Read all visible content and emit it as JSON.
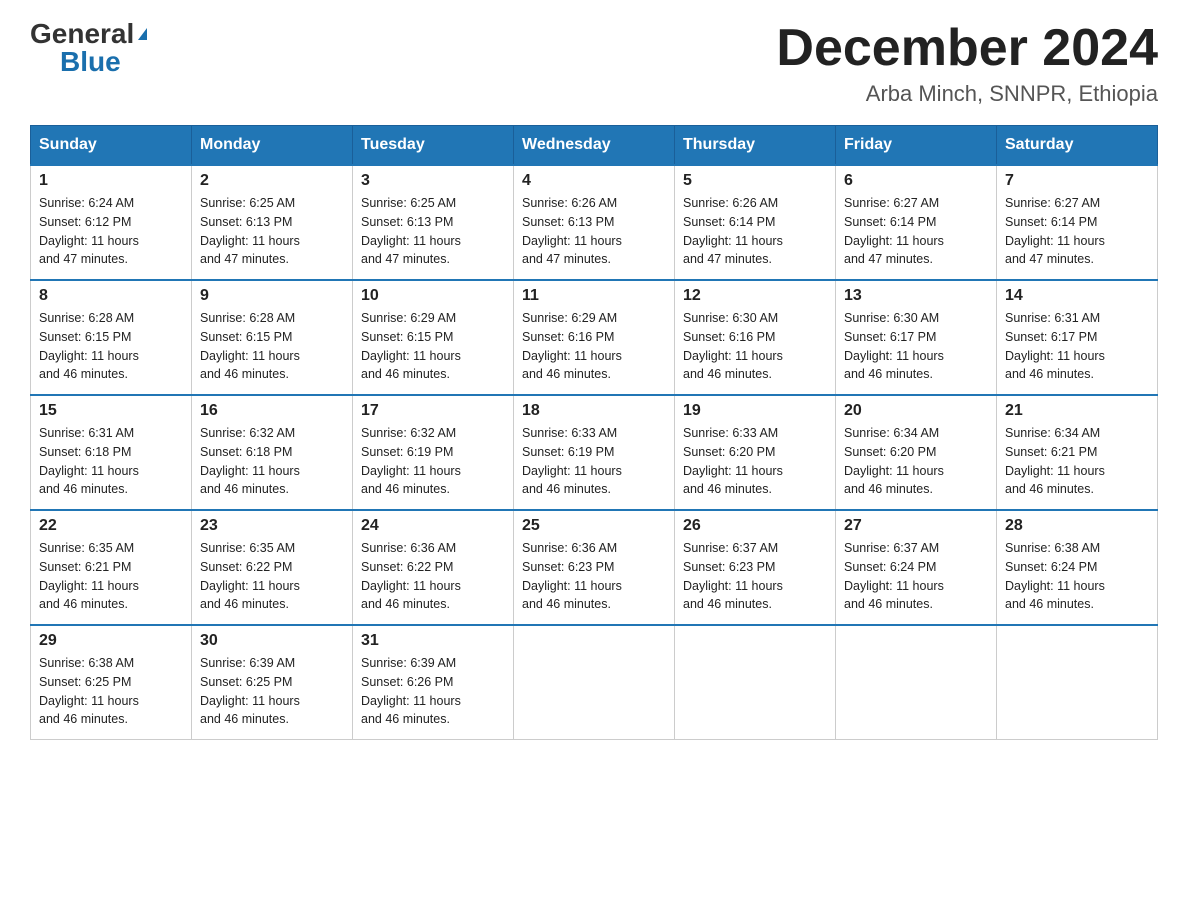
{
  "logo": {
    "general": "General",
    "blue": "Blue",
    "triangle": "▲"
  },
  "header": {
    "month": "December 2024",
    "location": "Arba Minch, SNNPR, Ethiopia"
  },
  "days_of_week": [
    "Sunday",
    "Monday",
    "Tuesday",
    "Wednesday",
    "Thursday",
    "Friday",
    "Saturday"
  ],
  "weeks": [
    [
      {
        "day": "1",
        "sunrise": "6:24 AM",
        "sunset": "6:12 PM",
        "daylight": "11 hours and 47 minutes."
      },
      {
        "day": "2",
        "sunrise": "6:25 AM",
        "sunset": "6:13 PM",
        "daylight": "11 hours and 47 minutes."
      },
      {
        "day": "3",
        "sunrise": "6:25 AM",
        "sunset": "6:13 PM",
        "daylight": "11 hours and 47 minutes."
      },
      {
        "day": "4",
        "sunrise": "6:26 AM",
        "sunset": "6:13 PM",
        "daylight": "11 hours and 47 minutes."
      },
      {
        "day": "5",
        "sunrise": "6:26 AM",
        "sunset": "6:14 PM",
        "daylight": "11 hours and 47 minutes."
      },
      {
        "day": "6",
        "sunrise": "6:27 AM",
        "sunset": "6:14 PM",
        "daylight": "11 hours and 47 minutes."
      },
      {
        "day": "7",
        "sunrise": "6:27 AM",
        "sunset": "6:14 PM",
        "daylight": "11 hours and 47 minutes."
      }
    ],
    [
      {
        "day": "8",
        "sunrise": "6:28 AM",
        "sunset": "6:15 PM",
        "daylight": "11 hours and 46 minutes."
      },
      {
        "day": "9",
        "sunrise": "6:28 AM",
        "sunset": "6:15 PM",
        "daylight": "11 hours and 46 minutes."
      },
      {
        "day": "10",
        "sunrise": "6:29 AM",
        "sunset": "6:15 PM",
        "daylight": "11 hours and 46 minutes."
      },
      {
        "day": "11",
        "sunrise": "6:29 AM",
        "sunset": "6:16 PM",
        "daylight": "11 hours and 46 minutes."
      },
      {
        "day": "12",
        "sunrise": "6:30 AM",
        "sunset": "6:16 PM",
        "daylight": "11 hours and 46 minutes."
      },
      {
        "day": "13",
        "sunrise": "6:30 AM",
        "sunset": "6:17 PM",
        "daylight": "11 hours and 46 minutes."
      },
      {
        "day": "14",
        "sunrise": "6:31 AM",
        "sunset": "6:17 PM",
        "daylight": "11 hours and 46 minutes."
      }
    ],
    [
      {
        "day": "15",
        "sunrise": "6:31 AM",
        "sunset": "6:18 PM",
        "daylight": "11 hours and 46 minutes."
      },
      {
        "day": "16",
        "sunrise": "6:32 AM",
        "sunset": "6:18 PM",
        "daylight": "11 hours and 46 minutes."
      },
      {
        "day": "17",
        "sunrise": "6:32 AM",
        "sunset": "6:19 PM",
        "daylight": "11 hours and 46 minutes."
      },
      {
        "day": "18",
        "sunrise": "6:33 AM",
        "sunset": "6:19 PM",
        "daylight": "11 hours and 46 minutes."
      },
      {
        "day": "19",
        "sunrise": "6:33 AM",
        "sunset": "6:20 PM",
        "daylight": "11 hours and 46 minutes."
      },
      {
        "day": "20",
        "sunrise": "6:34 AM",
        "sunset": "6:20 PM",
        "daylight": "11 hours and 46 minutes."
      },
      {
        "day": "21",
        "sunrise": "6:34 AM",
        "sunset": "6:21 PM",
        "daylight": "11 hours and 46 minutes."
      }
    ],
    [
      {
        "day": "22",
        "sunrise": "6:35 AM",
        "sunset": "6:21 PM",
        "daylight": "11 hours and 46 minutes."
      },
      {
        "day": "23",
        "sunrise": "6:35 AM",
        "sunset": "6:22 PM",
        "daylight": "11 hours and 46 minutes."
      },
      {
        "day": "24",
        "sunrise": "6:36 AM",
        "sunset": "6:22 PM",
        "daylight": "11 hours and 46 minutes."
      },
      {
        "day": "25",
        "sunrise": "6:36 AM",
        "sunset": "6:23 PM",
        "daylight": "11 hours and 46 minutes."
      },
      {
        "day": "26",
        "sunrise": "6:37 AM",
        "sunset": "6:23 PM",
        "daylight": "11 hours and 46 minutes."
      },
      {
        "day": "27",
        "sunrise": "6:37 AM",
        "sunset": "6:24 PM",
        "daylight": "11 hours and 46 minutes."
      },
      {
        "day": "28",
        "sunrise": "6:38 AM",
        "sunset": "6:24 PM",
        "daylight": "11 hours and 46 minutes."
      }
    ],
    [
      {
        "day": "29",
        "sunrise": "6:38 AM",
        "sunset": "6:25 PM",
        "daylight": "11 hours and 46 minutes."
      },
      {
        "day": "30",
        "sunrise": "6:39 AM",
        "sunset": "6:25 PM",
        "daylight": "11 hours and 46 minutes."
      },
      {
        "day": "31",
        "sunrise": "6:39 AM",
        "sunset": "6:26 PM",
        "daylight": "11 hours and 46 minutes."
      },
      null,
      null,
      null,
      null
    ]
  ],
  "labels": {
    "sunrise": "Sunrise:",
    "sunset": "Sunset:",
    "daylight": "Daylight:"
  }
}
